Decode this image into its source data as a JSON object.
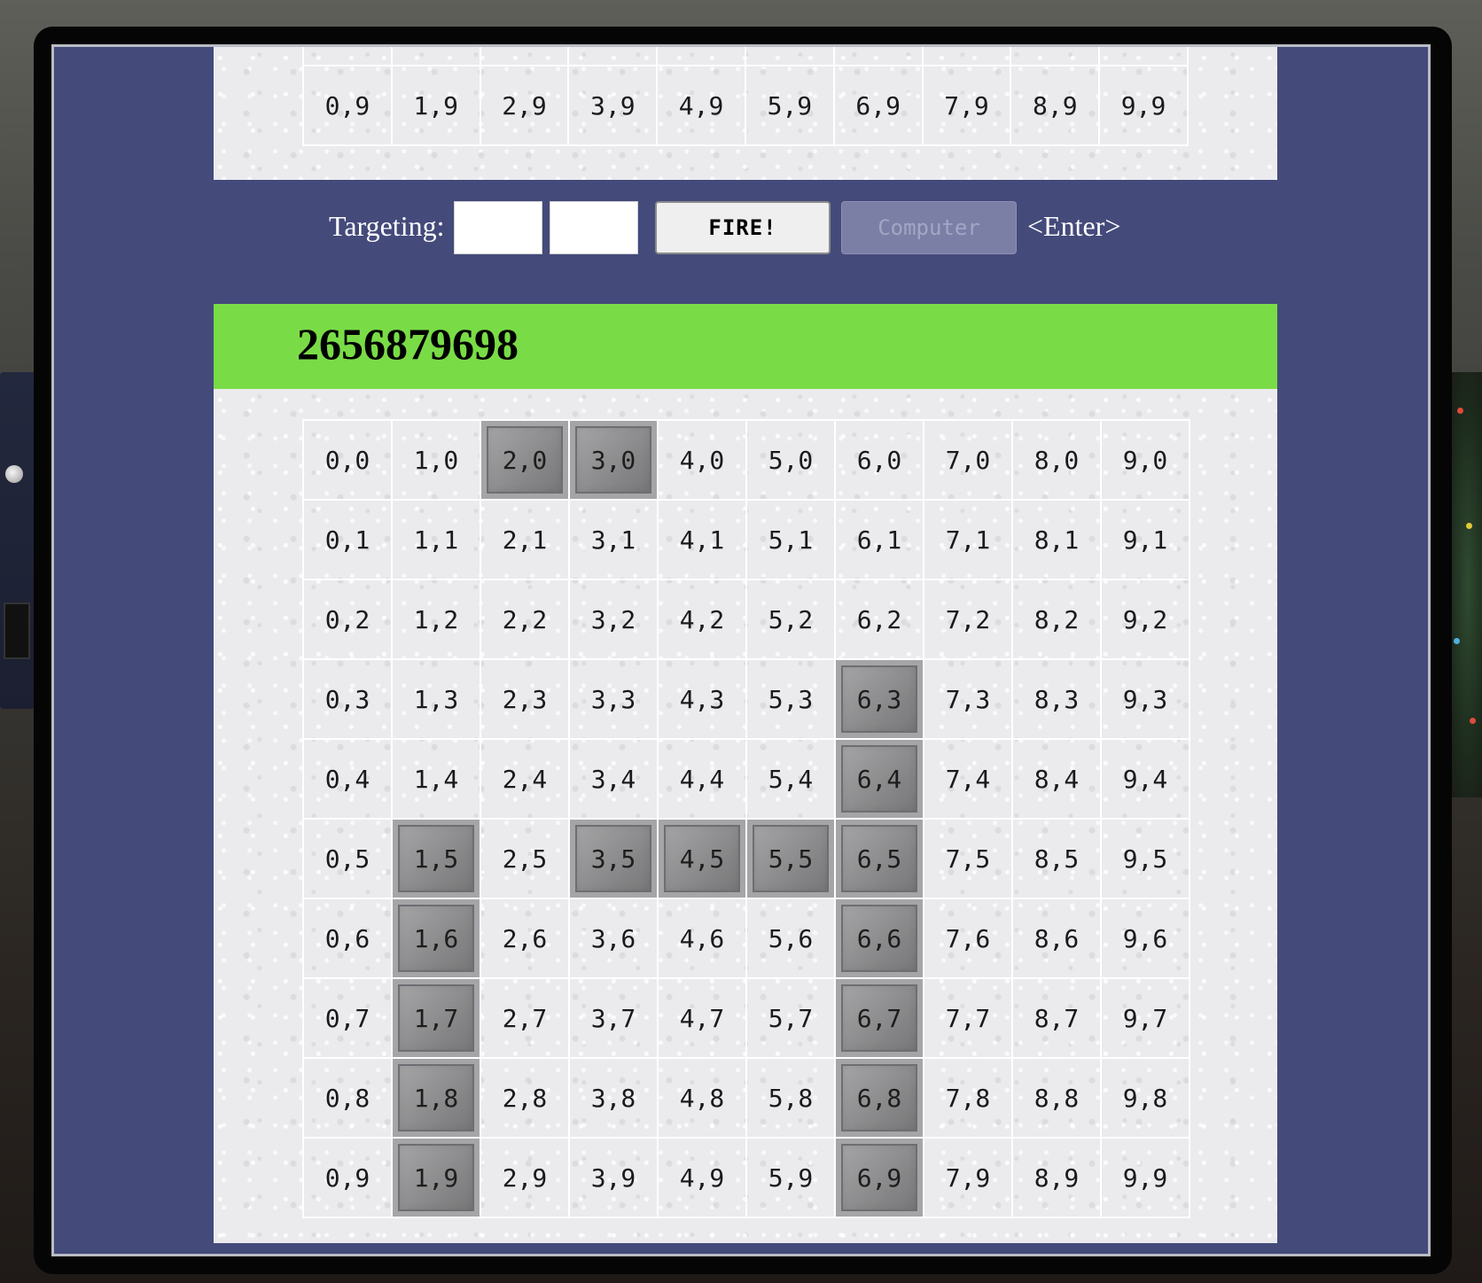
{
  "top_board": {
    "visible_row": [
      "0,9",
      "1,9",
      "2,9",
      "3,9",
      "4,9",
      "5,9",
      "6,9",
      "7,9",
      "8,9",
      "9,9"
    ]
  },
  "targeting": {
    "label": "Targeting:",
    "x_value": "",
    "y_value": "",
    "fire_label": "FIRE!",
    "computer_label": "Computer",
    "enter_hint": "<Enter>"
  },
  "player": {
    "id": "2656879698",
    "header_color": "#79dc46"
  },
  "bottom_board": {
    "rows": [
      [
        "0,0",
        "1,0",
        "2,0",
        "3,0",
        "4,0",
        "5,0",
        "6,0",
        "7,0",
        "8,0",
        "9,0"
      ],
      [
        "0,1",
        "1,1",
        "2,1",
        "3,1",
        "4,1",
        "5,1",
        "6,1",
        "7,1",
        "8,1",
        "9,1"
      ],
      [
        "0,2",
        "1,2",
        "2,2",
        "3,2",
        "4,2",
        "5,2",
        "6,2",
        "7,2",
        "8,2",
        "9,2"
      ],
      [
        "0,3",
        "1,3",
        "2,3",
        "3,3",
        "4,3",
        "5,3",
        "6,3",
        "7,3",
        "8,3",
        "9,3"
      ],
      [
        "0,4",
        "1,4",
        "2,4",
        "3,4",
        "4,4",
        "5,4",
        "6,4",
        "7,4",
        "8,4",
        "9,4"
      ],
      [
        "0,5",
        "1,5",
        "2,5",
        "3,5",
        "4,5",
        "5,5",
        "6,5",
        "7,5",
        "8,5",
        "9,5"
      ],
      [
        "0,6",
        "1,6",
        "2,6",
        "3,6",
        "4,6",
        "5,6",
        "6,6",
        "7,6",
        "8,6",
        "9,6"
      ],
      [
        "0,7",
        "1,7",
        "2,7",
        "3,7",
        "4,7",
        "5,7",
        "6,7",
        "7,7",
        "8,7",
        "9,7"
      ],
      [
        "0,8",
        "1,8",
        "2,8",
        "3,8",
        "4,8",
        "5,8",
        "6,8",
        "7,8",
        "8,8",
        "9,8"
      ],
      [
        "0,9",
        "1,9",
        "2,9",
        "3,9",
        "4,9",
        "5,9",
        "6,9",
        "7,9",
        "8,9",
        "9,9"
      ]
    ],
    "ship_cells": [
      "2,0",
      "3,0",
      "6,3",
      "6,4",
      "1,5",
      "3,5",
      "4,5",
      "5,5",
      "6,5",
      "1,6",
      "6,6",
      "1,7",
      "6,7",
      "1,8",
      "6,8",
      "1,9",
      "6,9"
    ]
  },
  "colors": {
    "screen_background": "#444a7a",
    "computer_button": "#7b7fa6"
  }
}
